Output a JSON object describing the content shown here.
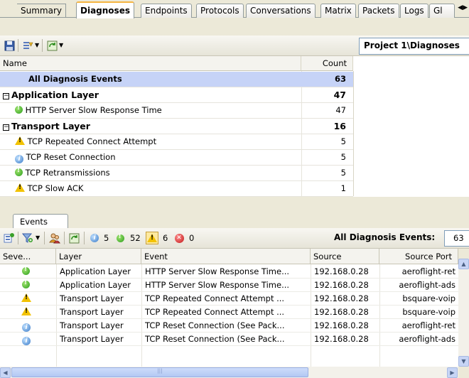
{
  "tabs": [
    {
      "label": "Summary",
      "active": false
    },
    {
      "label": "Diagnoses",
      "active": true
    },
    {
      "label": "Endpoints",
      "active": false
    },
    {
      "label": "Protocols",
      "active": false
    },
    {
      "label": "Conversations",
      "active": false
    },
    {
      "label": "Matrix",
      "active": false
    },
    {
      "label": "Packets",
      "active": false
    },
    {
      "label": "Logs",
      "active": false
    },
    {
      "label": "Gl",
      "active": false
    }
  ],
  "diagnoses": {
    "path": "Project 1\\Diagnoses",
    "columns": {
      "name": "Name",
      "count": "Count"
    },
    "rows": [
      {
        "name": "All Diagnosis Events",
        "count": "63",
        "kind": "all"
      },
      {
        "name": "Application Layer",
        "count": "47",
        "kind": "group"
      },
      {
        "name": "HTTP Server Slow Response Time",
        "count": "47",
        "kind": "item",
        "icon": "ok-icon"
      },
      {
        "name": "Transport Layer",
        "count": "16",
        "kind": "group"
      },
      {
        "name": "TCP Repeated Connect Attempt",
        "count": "5",
        "kind": "item",
        "icon": "warning-icon"
      },
      {
        "name": "TCP Reset Connection",
        "count": "5",
        "kind": "item",
        "icon": "info-icon"
      },
      {
        "name": "TCP Retransmissions",
        "count": "5",
        "kind": "item",
        "icon": "ok-icon"
      },
      {
        "name": "TCP Slow ACK",
        "count": "1",
        "kind": "item",
        "icon": "warning-icon"
      }
    ]
  },
  "events": {
    "tab_label": "Events",
    "filter_counts": {
      "info": "5",
      "ok": "52",
      "warning": "6",
      "error": "0"
    },
    "all_label": "All Diagnosis Events:",
    "all_value": "63",
    "columns": [
      "Seve...",
      "Layer",
      "Event",
      "Source",
      "Source Port"
    ],
    "rows": [
      {
        "severity": "ok-icon",
        "layer": "Application Layer",
        "event": "HTTP Server Slow Response Time...",
        "source": "192.168.0.28",
        "port": "aeroflight-ret"
      },
      {
        "severity": "ok-icon",
        "layer": "Application Layer",
        "event": "HTTP Server Slow Response Time...",
        "source": "192.168.0.28",
        "port": "aeroflight-ads"
      },
      {
        "severity": "warning-icon",
        "layer": "Transport Layer",
        "event": "TCP Repeated Connect Attempt ...",
        "source": "192.168.0.28",
        "port": "bsquare-voip"
      },
      {
        "severity": "warning-icon",
        "layer": "Transport Layer",
        "event": "TCP Repeated Connect Attempt ...",
        "source": "192.168.0.28",
        "port": "bsquare-voip"
      },
      {
        "severity": "info-icon",
        "layer": "Transport Layer",
        "event": "TCP Reset Connection (See Pack...",
        "source": "192.168.0.28",
        "port": "aeroflight-ret"
      },
      {
        "severity": "info-icon",
        "layer": "Transport Layer",
        "event": "TCP Reset Connection (See Pack...",
        "source": "192.168.0.28",
        "port": "aeroflight-ads"
      }
    ]
  },
  "colors": {
    "selection": "#c6d3f7",
    "active_tab_accent": "#f5b541",
    "toolbar": "#ece9d8"
  }
}
